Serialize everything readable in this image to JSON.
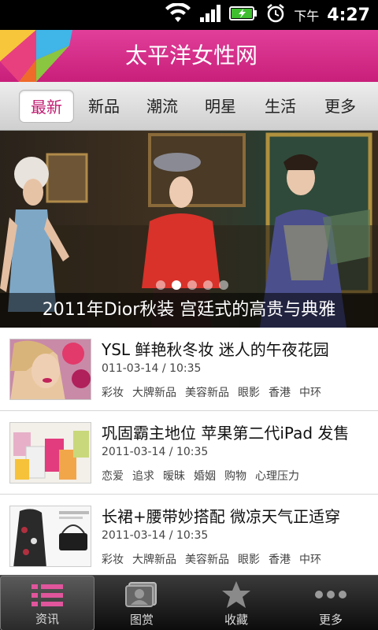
{
  "status_bar": {
    "ampm": "下午",
    "time": "4:27"
  },
  "header": {
    "title": "太平洋女性网"
  },
  "tabs": [
    {
      "label": "最新",
      "active": true
    },
    {
      "label": "新品",
      "active": false
    },
    {
      "label": "潮流",
      "active": false
    },
    {
      "label": "明星",
      "active": false
    },
    {
      "label": "生活",
      "active": false
    },
    {
      "label": "更多",
      "active": false
    }
  ],
  "banner": {
    "caption": "2011年Dior秋装 宫廷式的高贵与典雅",
    "page_count": 5,
    "active_page": 2
  },
  "articles": [
    {
      "title": "YSL 鲜艳秋冬妆 迷人的午夜花园",
      "date": "011-03-14 / 10:35",
      "tags": [
        "彩妆",
        "大牌新品",
        "美容新品",
        "眼影",
        "香港",
        "中环"
      ]
    },
    {
      "title": "巩固霸主地位  苹果第二代iPad 发售",
      "date": "2011-03-14 / 10:35",
      "tags": [
        "恋爱",
        "追求",
        "暧昧",
        "婚姻",
        "购物",
        "心理压力"
      ]
    },
    {
      "title": "长裙+腰带妙搭配 微凉天气正适穿",
      "date": "2011-03-14 / 10:35",
      "tags": [
        "彩妆",
        "大牌新品",
        "美容新品",
        "眼影",
        "香港",
        "中环"
      ]
    }
  ],
  "bottom_nav": [
    {
      "label": "资讯",
      "icon": "list-icon",
      "active": true
    },
    {
      "label": "图赏",
      "icon": "gallery-icon",
      "active": false
    },
    {
      "label": "收藏",
      "icon": "star-icon",
      "active": false
    },
    {
      "label": "更多",
      "icon": "more-dots-icon",
      "active": false
    }
  ],
  "colors": {
    "brand": "#d1287f",
    "active_tab_text": "#c11e73"
  }
}
